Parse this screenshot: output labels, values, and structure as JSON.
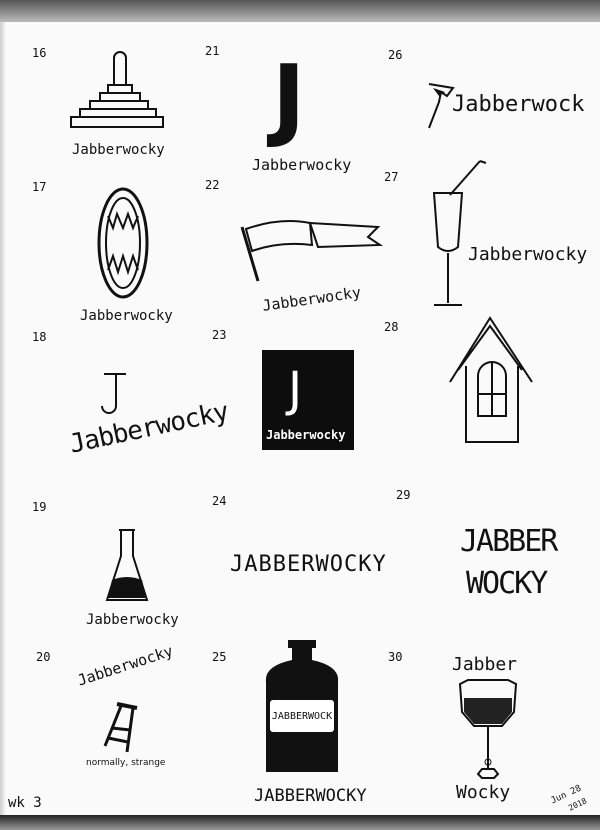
{
  "sketches": [
    {
      "number": "16",
      "label": "Jabberwocky"
    },
    {
      "number": "17",
      "label": "Jabberwocky"
    },
    {
      "number": "18",
      "label": "Jabberwocky"
    },
    {
      "number": "19",
      "label": "Jabberwocky"
    },
    {
      "number": "20",
      "label": "Jabberwocky",
      "tagline": "normally, strange"
    },
    {
      "number": "21",
      "label": "Jabberwocky",
      "mark": "J"
    },
    {
      "number": "22",
      "label": "Jabberwocky"
    },
    {
      "number": "23",
      "label": "Jabberwocky",
      "mark": "J"
    },
    {
      "number": "24",
      "label": "JABBERWOCKY"
    },
    {
      "number": "25",
      "label": "JABBERWOCKY",
      "bottle_label": "JABBERWOCK"
    },
    {
      "number": "26",
      "label": "Jabberwock"
    },
    {
      "number": "27",
      "label": "Jabberwocky"
    },
    {
      "number": "28",
      "label": ""
    },
    {
      "number": "29",
      "label_line1": "JABBER",
      "label_line2": "WOCKY"
    },
    {
      "number": "30",
      "label_line1": "Jabber",
      "label_line2": "Wocky"
    }
  ],
  "corner_note": "wk 3",
  "date_line1": "Jun 28",
  "date_line2": "2018"
}
